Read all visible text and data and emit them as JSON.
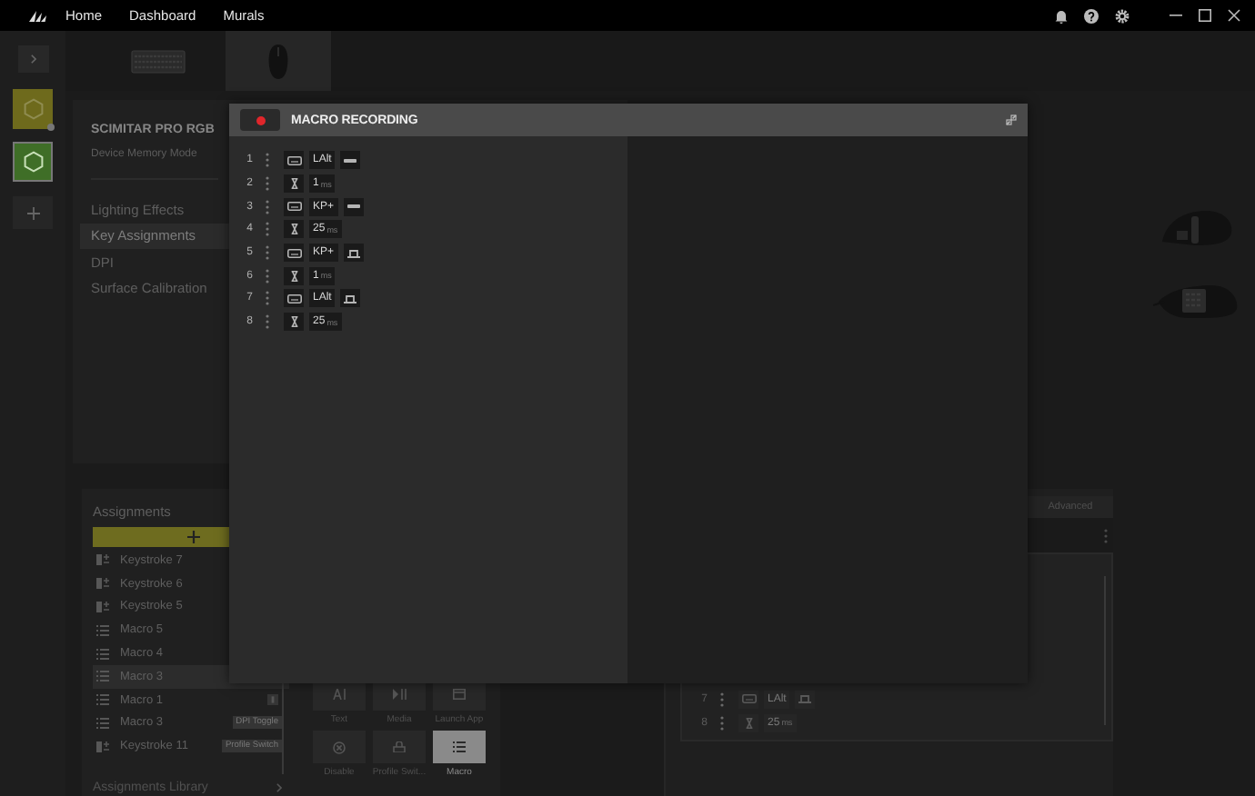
{
  "top_bar": {
    "nav": [
      {
        "label": "Home"
      },
      {
        "label": "Dashboard"
      },
      {
        "label": "Murals"
      }
    ]
  },
  "devices": [
    {
      "kind": "keyboard",
      "selected": false
    },
    {
      "kind": "mouse",
      "selected": true
    }
  ],
  "profiles": [
    {
      "color": "#6e6a1c",
      "selected": false,
      "indicator": true
    },
    {
      "color": "#3f6e27",
      "selected": true,
      "indicator": false
    }
  ],
  "device_panel": {
    "title": "SCIMITAR PRO RGB",
    "subtitle": "Device Memory Mode",
    "nav": [
      {
        "label": "Lighting Effects",
        "selected": false
      },
      {
        "label": "Key Assignments",
        "selected": true
      },
      {
        "label": "DPI",
        "selected": false
      },
      {
        "label": "Surface Calibration",
        "selected": false
      }
    ]
  },
  "assignments": {
    "title": "Assignments",
    "items": [
      {
        "kind": "keystroke",
        "label": "Keystroke 7",
        "selected": false
      },
      {
        "kind": "keystroke",
        "label": "Keystroke 6",
        "selected": false
      },
      {
        "kind": "keystroke",
        "label": "Keystroke 5",
        "selected": false
      },
      {
        "kind": "macro",
        "label": "Macro 5",
        "selected": false
      },
      {
        "kind": "macro",
        "label": "Macro 4",
        "selected": false
      },
      {
        "kind": "macro",
        "label": "Macro 3",
        "selected": true
      },
      {
        "kind": "macro",
        "label": "Macro 1",
        "selected": false,
        "badge_icon": true
      },
      {
        "kind": "macro",
        "label": "Macro 3",
        "selected": false,
        "tag": "DPI Toggle"
      },
      {
        "kind": "keystroke",
        "label": "Keystroke 11",
        "selected": false,
        "tag": "Profile Switch"
      }
    ],
    "library": "Assignments Library"
  },
  "types": [
    {
      "kind": "text",
      "label": "Text",
      "selected": false
    },
    {
      "kind": "media",
      "label": "Media",
      "selected": false
    },
    {
      "kind": "launch",
      "label": "Launch App",
      "selected": false
    },
    {
      "kind": "disable",
      "label": "Disable",
      "selected": false
    },
    {
      "kind": "profile",
      "label": "Profile Swit...",
      "selected": false
    },
    {
      "kind": "macro",
      "label": "Macro",
      "selected": true
    }
  ],
  "editor": {
    "tab": "Advanced",
    "rows": [
      {
        "number": "7",
        "kind": "key",
        "key": "LAlt",
        "pressed": false
      },
      {
        "number": "8",
        "kind": "delay",
        "value": "25",
        "unit": "ms"
      }
    ]
  },
  "modal": {
    "title": "MACRO RECORDING",
    "recording": true,
    "rows": [
      {
        "number": "1",
        "kind": "key",
        "key": "LAlt",
        "pressed": true
      },
      {
        "number": "2",
        "kind": "delay",
        "value": "1",
        "unit": "ms"
      },
      {
        "number": "3",
        "kind": "key",
        "key": "KP+",
        "pressed": true
      },
      {
        "number": "4",
        "kind": "delay",
        "value": "25",
        "unit": "ms"
      },
      {
        "number": "5",
        "kind": "key",
        "key": "KP+",
        "pressed": false
      },
      {
        "number": "6",
        "kind": "delay",
        "value": "1",
        "unit": "ms"
      },
      {
        "number": "7",
        "kind": "key",
        "key": "LAlt",
        "pressed": false
      },
      {
        "number": "8",
        "kind": "delay",
        "value": "25",
        "unit": "ms"
      }
    ]
  }
}
